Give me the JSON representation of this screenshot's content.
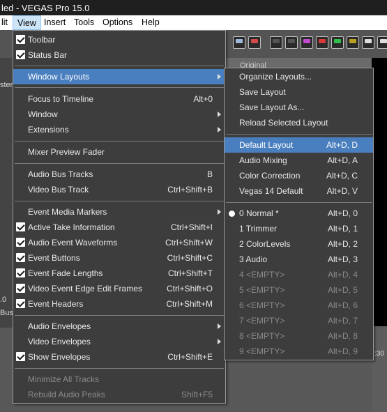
{
  "titlebar": {
    "title": "led - VEGAS Pro 15.0"
  },
  "menubar": {
    "items": [
      "lit",
      "View",
      "Insert",
      "Tools",
      "Options",
      "Help"
    ]
  },
  "background": {
    "strip_labels": [
      "ster",
      ".0",
      "Bus"
    ],
    "right_label": ":30",
    "orig_label": "Original"
  },
  "view_menu": {
    "items": [
      {
        "label": "Toolbar",
        "shortcut": "",
        "checked": true
      },
      {
        "label": "Status Bar",
        "shortcut": "",
        "checked": true
      },
      {
        "label": "Window Layouts",
        "shortcut": "",
        "submenu": true,
        "highlighted": true
      },
      {
        "label": "Focus to Timeline",
        "shortcut": "Alt+0"
      },
      {
        "label": "Window",
        "shortcut": "",
        "submenu": true
      },
      {
        "label": "Extensions",
        "shortcut": "",
        "submenu": true
      },
      {
        "label": "Mixer Preview Fader",
        "shortcut": ""
      },
      {
        "label": "Audio Bus Tracks",
        "shortcut": "B"
      },
      {
        "label": "Video Bus Track",
        "shortcut": "Ctrl+Shift+B"
      },
      {
        "label": "Event Media Markers",
        "shortcut": "",
        "submenu": true
      },
      {
        "label": "Active Take Information",
        "shortcut": "Ctrl+Shift+I",
        "checked": true
      },
      {
        "label": "Audio Event Waveforms",
        "shortcut": "Ctrl+Shift+W",
        "checked": true
      },
      {
        "label": "Event Buttons",
        "shortcut": "Ctrl+Shift+C",
        "checked": true
      },
      {
        "label": "Event Fade Lengths",
        "shortcut": "Ctrl+Shift+T",
        "checked": true
      },
      {
        "label": "Video Event Edge Edit Frames",
        "shortcut": "Ctrl+Shift+O",
        "checked": true
      },
      {
        "label": "Event Headers",
        "shortcut": "Ctrl+Shift+M",
        "checked": true
      },
      {
        "label": "Audio Envelopes",
        "shortcut": "",
        "submenu": true
      },
      {
        "label": "Video Envelopes",
        "shortcut": "",
        "submenu": true
      },
      {
        "label": "Show Envelopes",
        "shortcut": "Ctrl+Shift+E",
        "checked": true
      },
      {
        "label": "Minimize All Tracks",
        "shortcut": "",
        "disabled": true
      },
      {
        "label": "Rebuild Audio Peaks",
        "shortcut": "Shift+F5",
        "disabled": true
      }
    ]
  },
  "layout_menu": {
    "items": [
      {
        "label": "Organize Layouts...",
        "shortcut": ""
      },
      {
        "label": "Save Layout",
        "shortcut": ""
      },
      {
        "label": "Save Layout As...",
        "shortcut": ""
      },
      {
        "label": "Reload Selected Layout",
        "shortcut": ""
      },
      {
        "label": "Default Layout",
        "shortcut": "Alt+D, D",
        "highlighted": true
      },
      {
        "label": "Audio Mixing",
        "shortcut": "Alt+D, A"
      },
      {
        "label": "Color Correction",
        "shortcut": "Alt+D, C"
      },
      {
        "label": "Vegas 14 Default",
        "shortcut": "Alt+D, V"
      },
      {
        "label": "0 Normal *",
        "shortcut": "Alt+D, 0",
        "selected": true
      },
      {
        "label": "1 Trimmer",
        "shortcut": "Alt+D, 1"
      },
      {
        "label": "2 ColorLevels",
        "shortcut": "Alt+D, 2"
      },
      {
        "label": "3 Audio",
        "shortcut": "Alt+D, 3"
      },
      {
        "label": "4 <EMPTY>",
        "shortcut": "Alt+D, 4",
        "disabled": true
      },
      {
        "label": "5 <EMPTY>",
        "shortcut": "Alt+D, 5",
        "disabled": true
      },
      {
        "label": "6 <EMPTY>",
        "shortcut": "Alt+D, 6",
        "disabled": true
      },
      {
        "label": "7 <EMPTY>",
        "shortcut": "Alt+D, 7",
        "disabled": true
      },
      {
        "label": "8 <EMPTY>",
        "shortcut": "Alt+D, 8",
        "disabled": true
      },
      {
        "label": "9 <EMPTY>",
        "shortcut": "Alt+D, 9",
        "disabled": true
      }
    ]
  },
  "colors": {
    "menu_bg": "#3d3d3d",
    "highlight": "#4a7fbf",
    "disabled_text": "#8a8a8a"
  }
}
